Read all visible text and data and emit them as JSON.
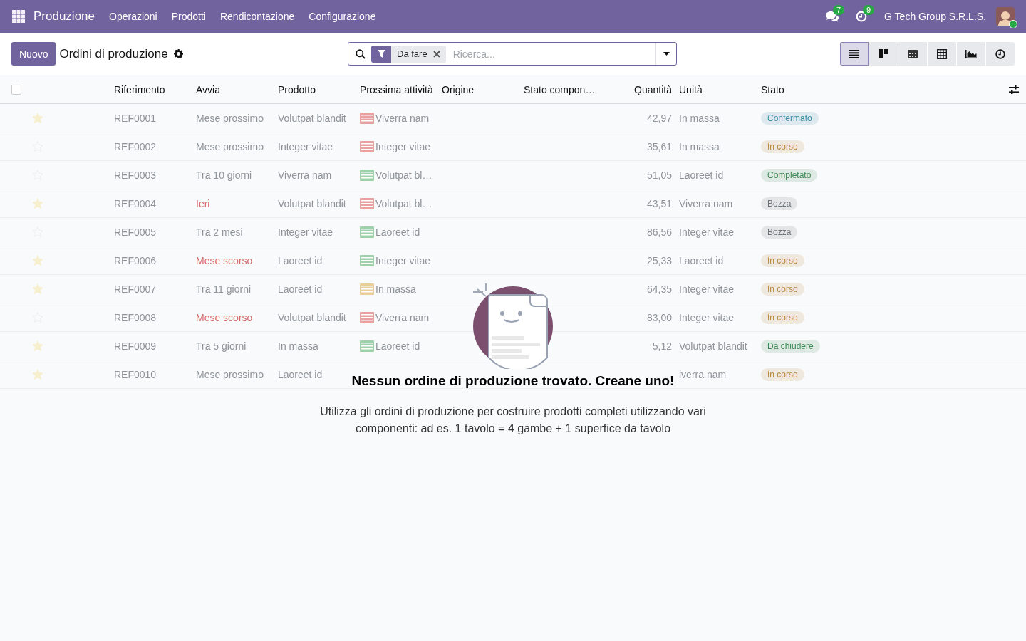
{
  "navbar": {
    "app_name": "Produzione",
    "menu": [
      "Operazioni",
      "Prodotti",
      "Rendicontazione",
      "Configurazione"
    ],
    "messages_count": "7",
    "activities_count": "9",
    "company": "G Tech Group S.R.L.S."
  },
  "control_panel": {
    "new_button": "Nuovo",
    "breadcrumb": "Ordini di produzione",
    "search": {
      "facets": [
        {
          "label": "Da fare"
        }
      ],
      "placeholder": "Ricerca..."
    },
    "views": [
      {
        "kind": "list",
        "selected": true
      },
      {
        "kind": "kanban",
        "selected": false
      },
      {
        "kind": "calendar",
        "selected": false
      },
      {
        "kind": "pivot",
        "selected": false
      },
      {
        "kind": "graph",
        "selected": false
      },
      {
        "kind": "activity",
        "selected": false
      }
    ]
  },
  "table": {
    "select_all_checked": false,
    "columns": [
      "Riferimento",
      "Avvia",
      "Prodotto",
      "Prossima attività",
      "Origine",
      "Stato compon…",
      "Quantità",
      "Unità",
      "Stato"
    ],
    "rows": [
      {
        "favorite": true,
        "reference": "REF0001",
        "start": "Mese prossimo",
        "start_overdue": false,
        "product": "Volutpat blandit",
        "activity": {
          "label": "Viverra nam",
          "color": "#e8a0a0"
        },
        "quantity": "42,97",
        "unit": "In massa",
        "status": {
          "label": "Confermato",
          "color": "#3a8ea5"
        }
      },
      {
        "favorite": false,
        "reference": "REF0002",
        "start": "Mese prossimo",
        "start_overdue": false,
        "product": "Integer vitae",
        "activity": {
          "label": "Integer vitae",
          "color": "#e8a0a0"
        },
        "quantity": "35,61",
        "unit": "In massa",
        "status": {
          "label": "In corso",
          "color": "#b8873a"
        }
      },
      {
        "favorite": false,
        "reference": "REF0003",
        "start": "Tra 10 giorni",
        "start_overdue": false,
        "product": "Viverra nam",
        "activity": {
          "label": "Volutpat bl…",
          "color": "#9fd0ac"
        },
        "quantity": "51,05",
        "unit": "Laoreet id",
        "status": {
          "label": "Completato",
          "color": "#3c8a54"
        }
      },
      {
        "favorite": true,
        "reference": "REF0004",
        "start": "Ieri",
        "start_overdue": true,
        "product": "Volutpat blandit",
        "activity": {
          "label": "Volutpat bl…",
          "color": "#e8a0a0"
        },
        "quantity": "43,51",
        "unit": "Viverra nam",
        "status": {
          "label": "Bozza",
          "color": "#6c737a"
        }
      },
      {
        "favorite": false,
        "reference": "REF0005",
        "start": "Tra 2 mesi",
        "start_overdue": false,
        "product": "Integer vitae",
        "activity": {
          "label": "Laoreet id",
          "color": "#9fd0ac"
        },
        "quantity": "86,56",
        "unit": "Integer vitae",
        "status": {
          "label": "Bozza",
          "color": "#6c737a"
        }
      },
      {
        "favorite": true,
        "reference": "REF0006",
        "start": "Mese scorso",
        "start_overdue": true,
        "product": "Laoreet id",
        "activity": {
          "label": "Integer vitae",
          "color": "#9fd0ac"
        },
        "quantity": "25,33",
        "unit": "Laoreet id",
        "status": {
          "label": "In corso",
          "color": "#b8873a"
        }
      },
      {
        "favorite": true,
        "reference": "REF0007",
        "start": "Tra 11 giorni",
        "start_overdue": false,
        "product": "Laoreet id",
        "activity": {
          "label": "In massa",
          "color": "#e8cf9a"
        },
        "quantity": "64,35",
        "unit": "Integer vitae",
        "status": {
          "label": "In corso",
          "color": "#b8873a"
        }
      },
      {
        "favorite": false,
        "reference": "REF0008",
        "start": "Mese scorso",
        "start_overdue": true,
        "product": "Volutpat blandit",
        "activity": {
          "label": "Viverra nam",
          "color": "#e8a0a0"
        },
        "quantity": "83,00",
        "unit": "Integer vitae",
        "status": {
          "label": "In corso",
          "color": "#b8873a"
        }
      },
      {
        "favorite": true,
        "reference": "REF0009",
        "start": "Tra 5 giorni",
        "start_overdue": false,
        "product": "In massa",
        "activity": {
          "label": "Laoreet id",
          "color": "#9fd0ac"
        },
        "quantity": "5,12",
        "unit": "Volutpat blandit",
        "status": {
          "label": "Da chiudere",
          "color": "#3c8a54"
        }
      },
      {
        "favorite": true,
        "reference": "REF0010",
        "start": "Mese prossimo",
        "start_overdue": false,
        "product": "Laoreet id",
        "unit": "iverra nam",
        "status": {
          "label": "In corso",
          "color": "#b8873a"
        }
      }
    ]
  },
  "empty_state": {
    "title": "Nessun ordine di produzione trovato. Creane uno!",
    "description": "Utilizza gli ordini di produzione per costruire prodotti completi utilizzando vari componenti: ad es. 1 tavolo = 4 gambe + 1 superfice da tavolo"
  }
}
